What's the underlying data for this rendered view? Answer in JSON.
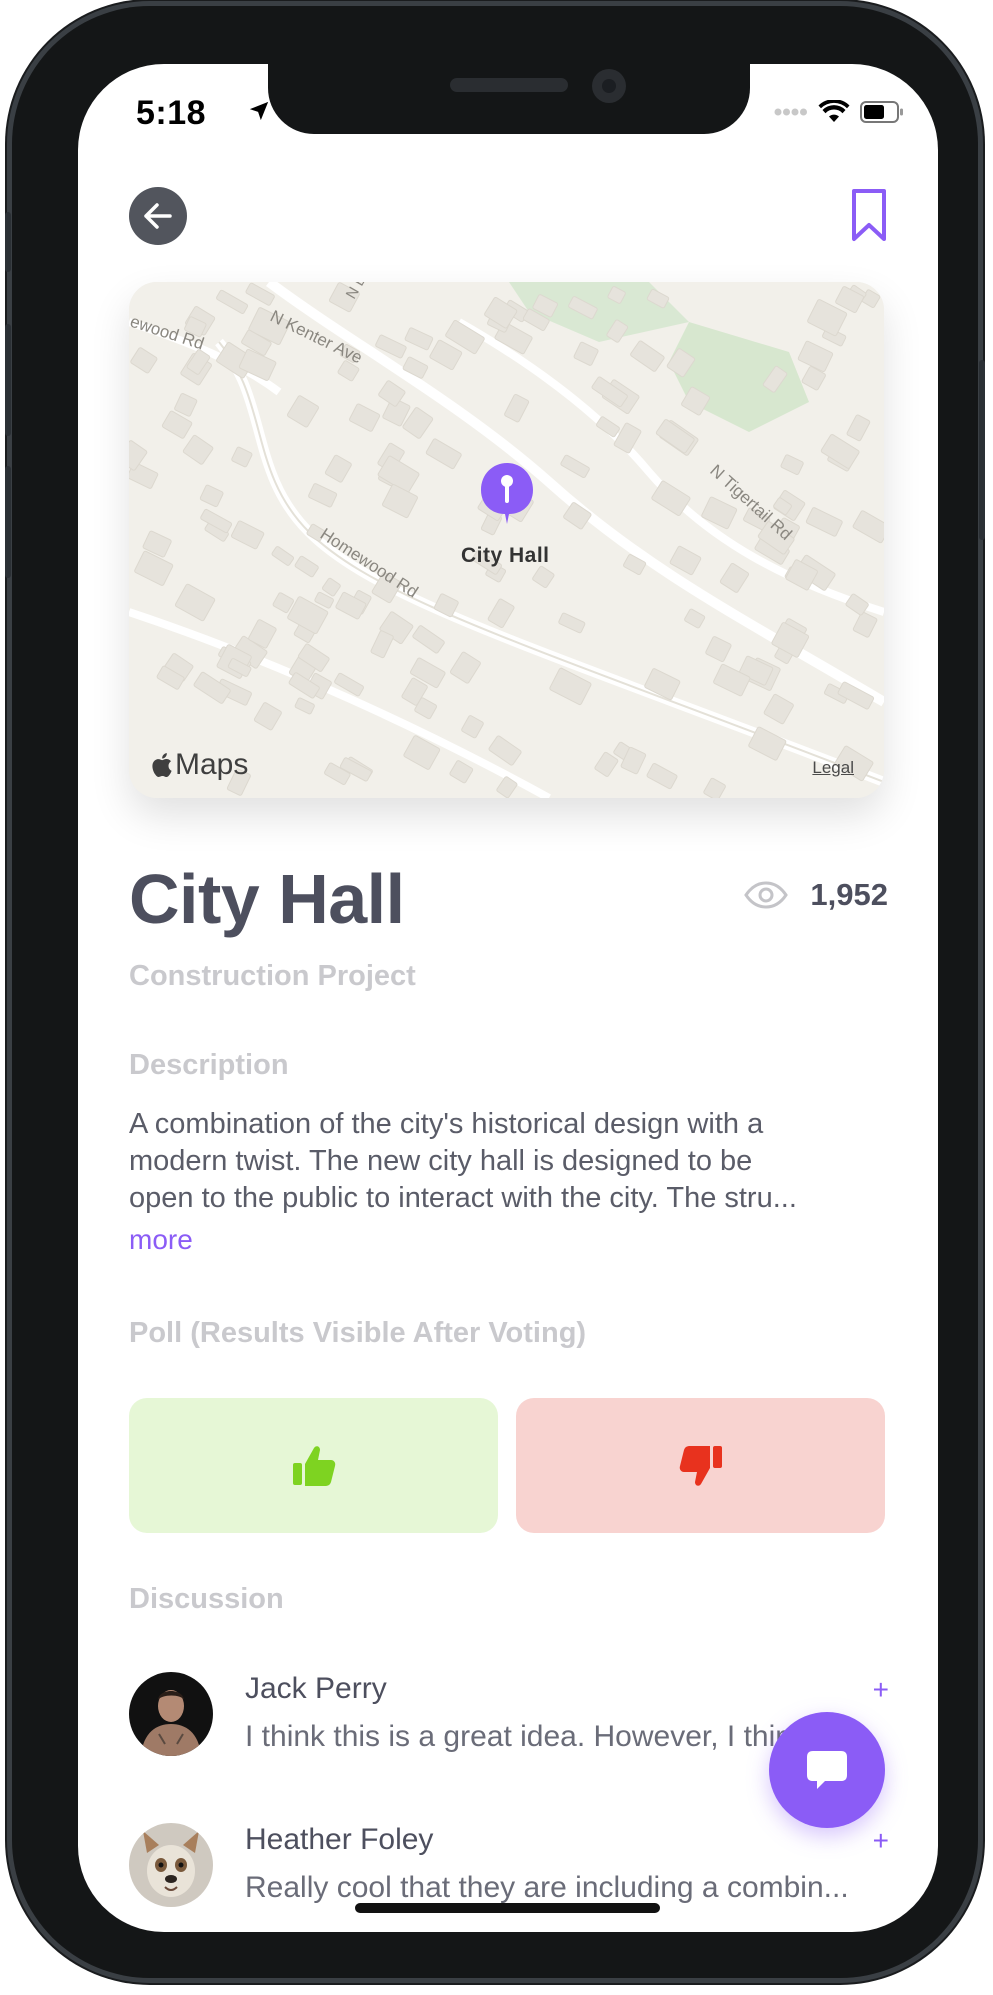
{
  "status_bar": {
    "time": "5:18"
  },
  "map": {
    "pin_label": "City Hall",
    "brand": "Maps",
    "legal": "Legal",
    "streets": [
      "N Kenter Ave",
      "ewood Rd",
      "Homewood Rd",
      "N Tigertail Rd",
      "N B"
    ]
  },
  "project": {
    "title": "City Hall",
    "subtitle": "Construction Project",
    "views": "1,952"
  },
  "description": {
    "label": "Description",
    "lines": [
      "A combination of the city's historical design with a",
      "modern twist. The new city hall is designed to be",
      "open to the public to interact with the city. The stru..."
    ],
    "more": "more"
  },
  "poll": {
    "label": "Poll (Results Visible After Voting)",
    "up_color": "#7ed321",
    "down_color": "#e8321e"
  },
  "discussion": {
    "label": "Discussion",
    "comments": [
      {
        "name": "Jack Perry",
        "text": "I think this is a great idea. However, I think t...",
        "action": "+"
      },
      {
        "name": "Heather Foley",
        "text": "Really cool that they are including a combin...",
        "action": "+"
      }
    ]
  },
  "colors": {
    "accent": "#8b5cf6",
    "title": "#4d4f5e",
    "muted": "#c9c9cd"
  }
}
